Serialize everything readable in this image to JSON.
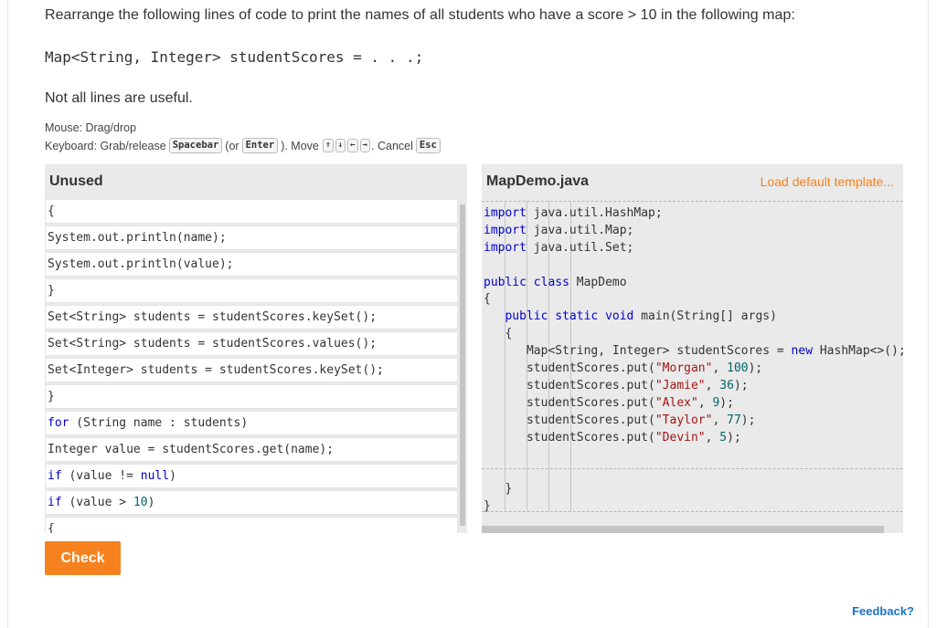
{
  "prompt": "Rearrange the following lines of code to print the names of all students who have a score > 10 in the following map:",
  "declaration": "Map<String, Integer> studentScores = . . .;",
  "note": "Not all lines are useful.",
  "mouse_hint": "Mouse: Drag/drop",
  "keyboard": {
    "prefix": "Keyboard: Grab/release",
    "grab_key": "Spacebar",
    "or_text": "(or",
    "enter_key": "Enter",
    "move_text": "). Move",
    "up_key": "↑",
    "down_key": "↓",
    "left_key": "←",
    "right_key": "→",
    "cancel_text": ". Cancel",
    "esc_key": "Esc"
  },
  "unused": {
    "title": "Unused",
    "lines": [
      "{",
      "System.out.println(name);",
      "System.out.println(value);",
      "}",
      "Set<String> students = studentScores.keySet();",
      "Set<String> students = studentScores.values();",
      "Set<Integer> students = studentScores.keySet();",
      "}",
      "for (String name : students)",
      "Integer value = studentScores.get(name);",
      "if (value != null)",
      "if (value > 10)",
      "{"
    ]
  },
  "check_label": "Check",
  "editor": {
    "file_name": "MapDemo.java",
    "load_default": "Load default template...",
    "code_lines": [
      "import java.util.HashMap;",
      "import java.util.Map;",
      "import java.util.Set;",
      "",
      "public class MapDemo",
      "{",
      "   public static void main(String[] args)",
      "   {",
      "      Map<String, Integer> studentScores = new HashMap<>();",
      "      studentScores.put(\"Morgan\", 100);",
      "      studentScores.put(\"Jamie\", 36);",
      "      studentScores.put(\"Alex\", 9);",
      "      studentScores.put(\"Taylor\", 77);",
      "      studentScores.put(\"Devin\", 5);",
      "",
      "",
      "   }",
      "}"
    ]
  },
  "feedback_label": "Feedback?",
  "colors": {
    "accent": "#f5821f",
    "keyword": "#0000cc",
    "string": "#a31515",
    "number": "#006666",
    "link": "#1a73c8"
  }
}
